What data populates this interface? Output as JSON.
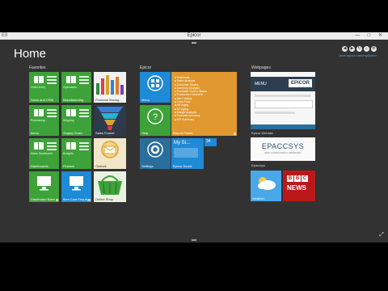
{
  "window": {
    "title": "Epicor",
    "left_text": "E9",
    "controls": {
      "minimize": "—",
      "maximize": "□",
      "close": "✕"
    }
  },
  "home_title": "Home",
  "top_right": {
    "nav_icons": [
      "back-icon",
      "forward-icon",
      "refresh-icon",
      "home-icon",
      "settings-icon"
    ],
    "link": "www.epicor.com/myEpicor"
  },
  "groups": {
    "favorites": "Favorites",
    "epicor": "Epicor",
    "webpages": "Webpages"
  },
  "favorites_tiles": [
    {
      "label": "Sales and CRM",
      "sub": "Order Entry"
    },
    {
      "label": "Manufacturing",
      "sub": "Operations"
    },
    {
      "label": "Financial Manag..."
    },
    {
      "label": "Items",
      "sub": "Purchasing"
    },
    {
      "label": "Supply Chain",
      "sub": "Shipping"
    },
    {
      "label": "Sales Funnel"
    },
    {
      "label": "Dashboards",
      "sub": "Sales Dashboard"
    },
    {
      "label": "Finance",
      "sub": "Budgets"
    },
    {
      "label": "Outlook"
    },
    {
      "label": "Dashboard Base"
    },
    {
      "label": "Item Cost Enquiry"
    },
    {
      "label": "Online Shop"
    }
  ],
  "epicor_tiles": {
    "menu": "Menu",
    "help": "Help",
    "settings": "Settings",
    "report_points": "Report Points",
    "my_site_title": "My Si...",
    "my_site_count": "34",
    "my_site_label": "Epicor Social",
    "report_items": [
      "Financials",
      "Sales Analysis",
      "Customer Orders",
      "Inventory Analysis",
      "Purchase Orders Status",
      "Production Schedule",
      "Job Costing",
      "Cash Flow",
      "AR Aging",
      "AP Aging",
      "Margin Analysis",
      "Forecast Accuracy",
      "KPI Summary"
    ]
  },
  "webpages_tiles": {
    "epicor_site": "Epicor Website",
    "epicor_site_menu": "MENU",
    "epicor_site_logo": "EPICOR",
    "epaccsys": "Epaccsys",
    "epaccsys_logo": "EPACCSYS",
    "epaccsys_sub": "ERP CONSULTANCY SERVICES",
    "weather": "Weather",
    "bbc_b1": "B",
    "bbc_b2": "B",
    "bbc_c": "C",
    "bbc_news": "NEWS",
    "bbc_label": "BBC News"
  },
  "colors": {
    "tile_green": "#3ea23a",
    "tile_blue": "#1f8ad6",
    "tile_orange": "#e0982f",
    "background": "#323232"
  }
}
